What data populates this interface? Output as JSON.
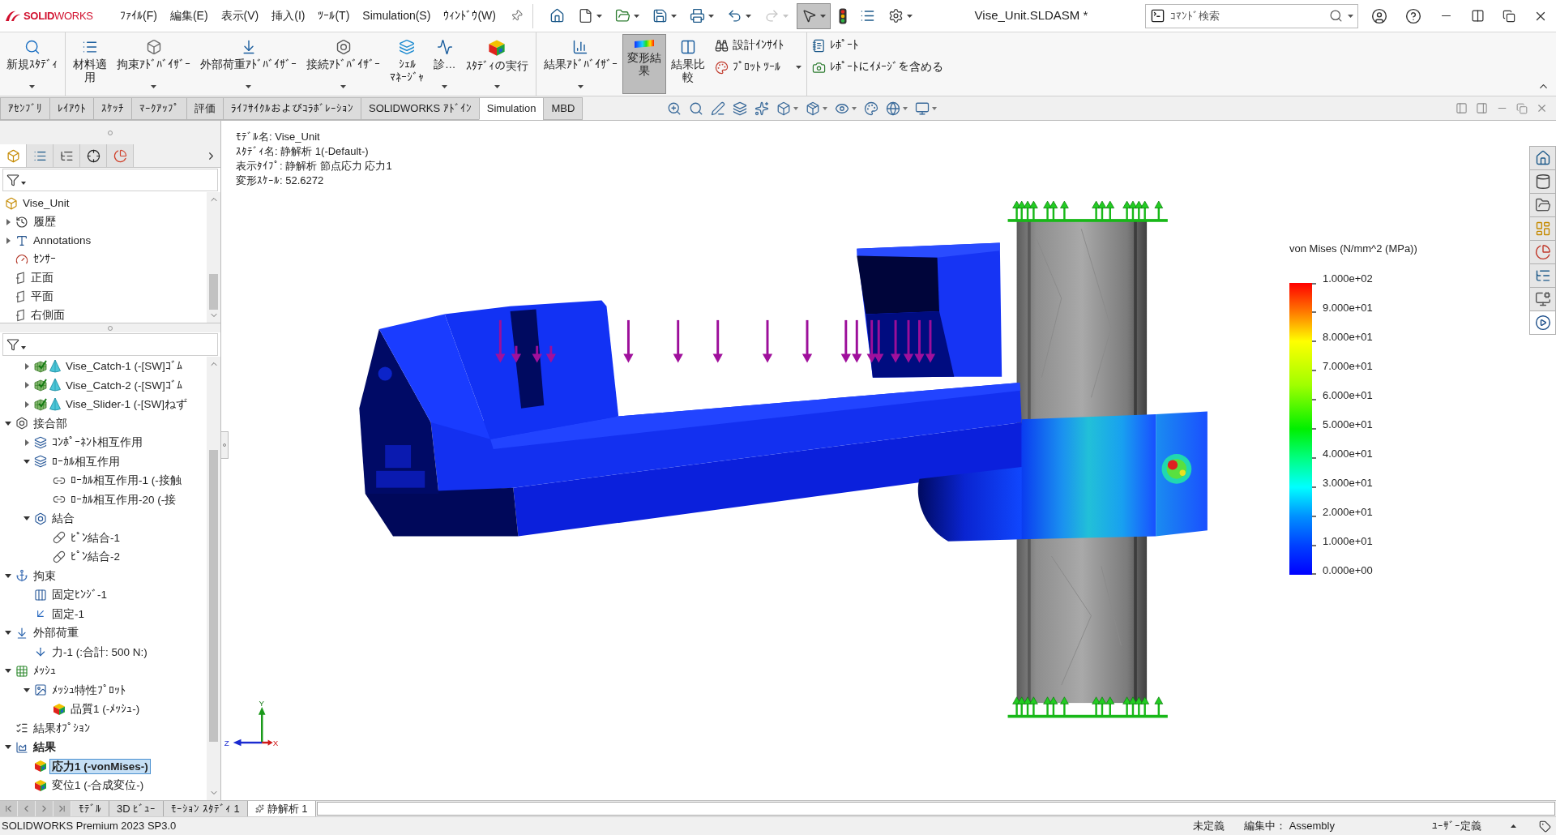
{
  "title_bar": {
    "logo": "**SOLID**WORKS",
    "menu": [
      "ﾌｧｲﾙ(F)",
      "編集(E)",
      "表示(V)",
      "挿入(I)",
      "ﾂｰﾙ(T)",
      "Simulation(S)",
      "ｳｨﾝﾄﾞｳ(W)"
    ],
    "quick_access": [
      {
        "dropdown": false,
        "selected": false,
        "disabled": false
      },
      {
        "dropdown": true,
        "selected": false,
        "disabled": false
      },
      {
        "dropdown": true,
        "selected": false,
        "disabled": false
      },
      {
        "dropdown": true,
        "selected": false,
        "disabled": false
      },
      {
        "dropdown": true,
        "selected": false,
        "disabled": false
      },
      {
        "dropdown": true,
        "selected": false,
        "disabled": false
      },
      {
        "dropdown": true,
        "selected": false,
        "disabled": true
      },
      {
        "dropdown": true,
        "selected": true,
        "disabled": false
      },
      {
        "dropdown": false,
        "selected": false,
        "disabled": false
      },
      {
        "dropdown": false,
        "selected": false,
        "disabled": false
      },
      {
        "dropdown": true,
        "selected": false,
        "disabled": false
      }
    ],
    "document_title": "Vise_Unit.SLDASM *",
    "search": {
      "placeholder": "ｺﾏﾝﾄﾞ検索"
    }
  },
  "ribbon": {
    "groups": [
      {
        "buttons": [
          {
            "label_lines": [
              "新規ｽﾀﾃﾞｨ"
            ],
            "dropdown": true,
            "selected": false
          }
        ]
      },
      {
        "buttons": [
          {
            "label_lines": [
              "材料適",
              "用"
            ],
            "dropdown": false,
            "selected": false
          },
          {
            "label_lines": [
              "拘束ｱﾄﾞﾊﾞｲｻﾞｰ"
            ],
            "dropdown": true,
            "selected": false
          },
          {
            "label_lines": [
              "外部荷重ｱﾄﾞﾊﾞｲｻﾞｰ"
            ],
            "dropdown": true,
            "selected": false
          },
          {
            "label_lines": [
              "接続ｱﾄﾞﾊﾞｲｻﾞｰ"
            ],
            "dropdown": true,
            "selected": false
          },
          {
            "label_lines": [
              "ｼｪﾙ",
              "ﾏﾈｰｼﾞｬ"
            ],
            "dropdown": false,
            "selected": false
          },
          {
            "label_lines": [
              "診…"
            ],
            "dropdown": true,
            "selected": false
          },
          {
            "label_lines": [
              "ｽﾀﾃﾞｨの実行"
            ],
            "dropdown": true,
            "selected": false
          }
        ]
      },
      {
        "buttons": [
          {
            "label_lines": [
              "結果ｱﾄﾞﾊﾞｲｻﾞｰ"
            ],
            "dropdown": true,
            "selected": false
          },
          {
            "label_lines": [
              "変形結",
              "果"
            ],
            "dropdown": false,
            "selected": true
          },
          {
            "label_lines": [
              "結果比",
              "較"
            ],
            "dropdown": false,
            "selected": false
          }
        ]
      }
    ],
    "small_groups": [
      {
        "buttons": [
          {
            "label": "設計ｲﾝｻｲﾄ",
            "dropdown": false
          },
          {
            "label": "ﾌﾟﾛｯﾄ ﾂｰﾙ",
            "dropdown": true
          }
        ]
      },
      {
        "buttons": [
          {
            "label": "ﾚﾎﾟｰﾄ",
            "dropdown": false
          },
          {
            "label": "ﾚﾎﾟｰﾄにｲﾒｰｼﾞを含める",
            "dropdown": false
          }
        ]
      }
    ]
  },
  "tabs": [
    {
      "label": "ｱｾﾝﾌﾞﾘ",
      "selected": false
    },
    {
      "label": "ﾚｲｱｳﾄ",
      "selected": false
    },
    {
      "label": "ｽｹｯﾁ",
      "selected": false
    },
    {
      "label": "ﾏｰｸｱｯﾌﾟ",
      "selected": false
    },
    {
      "label": "評価",
      "selected": false
    },
    {
      "label": "ﾗｲﾌｻｲｸﾙおよびｺﾗﾎﾞﾚｰｼｮﾝ",
      "selected": false
    },
    {
      "label": "SOLIDWORKS ｱﾄﾞｲﾝ",
      "selected": false
    },
    {
      "label": "Simulation",
      "selected": true
    },
    {
      "label": "MBD",
      "selected": false
    }
  ],
  "feature_tree": {
    "tabs": [
      {
        "selected": true
      },
      {
        "selected": false
      },
      {
        "selected": false
      },
      {
        "selected": false
      },
      {
        "selected": false
      }
    ],
    "root": {
      "label": "Vise_Unit",
      "kind": "assembly",
      "selected": false,
      "children": [
        {
          "label": "履歴",
          "kind": "history",
          "expanded": false,
          "selected": false
        },
        {
          "label": "Annotations",
          "kind": "annotations",
          "expanded": false,
          "selected": false
        },
        {
          "label": "ｾﾝｻｰ",
          "kind": "sensor",
          "selected": false
        },
        {
          "label": "正面",
          "kind": "plane",
          "selected": false
        },
        {
          "label": "平面",
          "kind": "plane",
          "selected": false
        },
        {
          "label": "右側面",
          "kind": "plane",
          "selected": false
        }
      ]
    }
  },
  "study_tree": {
    "scrolled_parent_children": [
      {
        "label": "Vise_Catch-1 (-[SW]ｺﾞﾑ",
        "kind": "part",
        "expanded": false,
        "selected": false,
        "active": false
      },
      {
        "label": "Vise_Catch-2 (-[SW]ｺﾞﾑ",
        "kind": "part",
        "expanded": false,
        "selected": false,
        "active": false
      },
      {
        "label": "Vise_Slider-1 (-[SW]ねず",
        "kind": "part",
        "expanded": false,
        "selected": false,
        "active": false
      }
    ],
    "items": [
      {
        "label": "接合部",
        "kind": "connections",
        "expanded": true,
        "selected": false,
        "active": false,
        "children": [
          {
            "label": "ｺﾝﾎﾟｰﾈﾝﾄ相互作用",
            "kind": "interactions",
            "expanded": false,
            "selected": false,
            "active": false
          },
          {
            "label": "ﾛｰｶﾙ相互作用",
            "kind": "interactions",
            "expanded": true,
            "selected": false,
            "active": false,
            "children": [
              {
                "label": "ﾛｰｶﾙ相互作用-1 (-接触",
                "kind": "contact",
                "selected": false,
                "active": false
              },
              {
                "label": "ﾛｰｶﾙ相互作用-20 (-接",
                "kind": "contact",
                "selected": false,
                "active": false
              }
            ]
          },
          {
            "label": "結合",
            "kind": "connectors",
            "expanded": true,
            "selected": false,
            "active": false,
            "children": [
              {
                "label": "ﾋﾟﾝ結合-1",
                "kind": "pin",
                "selected": false,
                "active": false
              },
              {
                "label": "ﾋﾟﾝ結合-2",
                "kind": "pin",
                "selected": false,
                "active": false
              }
            ]
          }
        ]
      },
      {
        "label": "拘束",
        "kind": "fixtures",
        "expanded": true,
        "selected": false,
        "active": false,
        "children": [
          {
            "label": "固定ﾋﾝｼﾞ-1",
            "kind": "hinge",
            "selected": false,
            "active": false
          },
          {
            "label": "固定-1",
            "kind": "fixed",
            "selected": false,
            "active": false
          }
        ]
      },
      {
        "label": "外部荷重",
        "kind": "loads",
        "expanded": true,
        "selected": false,
        "active": false,
        "children": [
          {
            "label": "力-1 (:合計: 500 N:)",
            "kind": "force",
            "selected": false,
            "active": false
          }
        ]
      },
      {
        "label": "ﾒｯｼｭ",
        "kind": "mesh",
        "expanded": true,
        "selected": false,
        "active": false,
        "children": [
          {
            "label": "ﾒｯｼｭ特性ﾌﾟﾛｯﾄ",
            "kind": "plotfolder",
            "expanded": true,
            "selected": false,
            "active": false,
            "children": [
              {
                "label": "品質1 (-ﾒｯｼｭ-)",
                "kind": "plot",
                "selected": false,
                "active": false
              }
            ]
          }
        ]
      },
      {
        "label": "結果ｵﾌﾟｼｮﾝ",
        "kind": "options",
        "selected": false,
        "active": false
      },
      {
        "label": "結果",
        "kind": "results",
        "expanded": true,
        "selected": false,
        "active": true,
        "children": [
          {
            "label": "応力1 (-vonMises-)",
            "kind": "plot",
            "selected": true,
            "active": true
          },
          {
            "label": "変位1 (-合成変位-)",
            "kind": "plot",
            "selected": false,
            "active": false
          }
        ]
      }
    ]
  },
  "viewport": {
    "info_lines": [
      "ﾓﾃﾞﾙ名: Vise_Unit",
      "ｽﾀﾃﾞｨ名: 静解析 1(-Default-)",
      "表示ﾀｲﾌﾟ: 静解析 節点応力 応力1",
      "変形ｽｹｰﾙ: 52.6272"
    ],
    "legend": {
      "title": "von Mises (N/mm^2 (MPa))",
      "labels": [
        "1.000e+02",
        "9.000e+01",
        "8.000e+01",
        "7.000e+01",
        "6.000e+01",
        "5.000e+01",
        "4.000e+01",
        "3.000e+01",
        "2.000e+01",
        "1.000e+01",
        "0.000e+00"
      ]
    },
    "triad": {
      "y": "Y",
      "z": "Z",
      "x": "X"
    }
  },
  "bottom_tabs": [
    {
      "label": "ﾓﾃﾞﾙ",
      "kind": "sheet",
      "selected": false
    },
    {
      "label": "3D ﾋﾞｭｰ",
      "kind": "sheet",
      "selected": false
    },
    {
      "label": "ﾓｰｼｮﾝ ｽﾀﾃﾞｨ 1",
      "kind": "sheet",
      "selected": false
    },
    {
      "label": "静解析 1",
      "kind": "study",
      "selected": true
    }
  ],
  "status_bar": {
    "product": "SOLIDWORKS Premium 2023 SP3.0",
    "state": "未定義",
    "editing": "編集中： Assembly",
    "units": "ﾕｰｻﾞｰ定義"
  }
}
